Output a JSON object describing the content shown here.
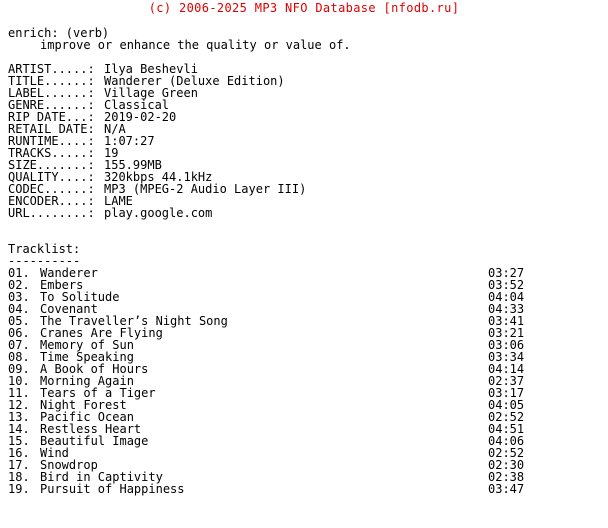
{
  "banner": {
    "text": "(c) 2006-2025 MP3 NFO Database [nfodb.ru]",
    "color": "#e00000"
  },
  "definition": {
    "term": "enrich: (verb)",
    "meaning": "improve or enhance the quality or value of."
  },
  "metadata": [
    {
      "key": "ARTIST.....:",
      "value": "Ilya Beshevli"
    },
    {
      "key": "TITLE......:",
      "value": "Wanderer (Deluxe Edition)"
    },
    {
      "key": "LABEL......:",
      "value": "Village Green"
    },
    {
      "key": "GENRE......:",
      "value": "Classical"
    },
    {
      "key": "RIP DATE...:",
      "value": "2019-02-20"
    },
    {
      "key": "RETAIL DATE:",
      "value": "N/A"
    },
    {
      "key": "RUNTIME....:",
      "value": "1:07:27"
    },
    {
      "key": "TRACKS.....:",
      "value": "19"
    },
    {
      "key": "SIZE.......:",
      "value": "155.99MB"
    },
    {
      "key": "QUALITY....:",
      "value": "320kbps 44.1kHz"
    },
    {
      "key": "CODEC......:",
      "value": "MP3 (MPEG-2 Audio Layer III)"
    },
    {
      "key": "ENCODER....:",
      "value": "LAME"
    },
    {
      "key": "URL........:",
      "value": "play.google.com"
    }
  ],
  "tracklist": {
    "heading": "Tracklist:",
    "rule": "----------",
    "tracks": [
      {
        "num": "01.",
        "title": "Wanderer",
        "time": "03:27"
      },
      {
        "num": "02.",
        "title": "Embers",
        "time": "03:52"
      },
      {
        "num": "03.",
        "title": "To Solitude",
        "time": "04:04"
      },
      {
        "num": "04.",
        "title": "Covenant",
        "time": "04:33"
      },
      {
        "num": "05.",
        "title": "The Traveller’s Night Song",
        "time": "03:41"
      },
      {
        "num": "06.",
        "title": "Cranes Are Flying",
        "time": "03:21"
      },
      {
        "num": "07.",
        "title": "Memory of Sun",
        "time": "03:06"
      },
      {
        "num": "08.",
        "title": "Time Speaking",
        "time": "03:34"
      },
      {
        "num": "09.",
        "title": "A Book of Hours",
        "time": "04:14"
      },
      {
        "num": "10.",
        "title": "Morning Again",
        "time": "02:37"
      },
      {
        "num": "11.",
        "title": "Tears of a Tiger",
        "time": "03:17"
      },
      {
        "num": "12.",
        "title": "Night Forest",
        "time": "04:05"
      },
      {
        "num": "13.",
        "title": "Pacific Ocean",
        "time": "02:52"
      },
      {
        "num": "14.",
        "title": "Restless Heart",
        "time": "04:51"
      },
      {
        "num": "15.",
        "title": "Beautiful Image",
        "time": "04:06"
      },
      {
        "num": "16.",
        "title": "Wind",
        "time": "02:52"
      },
      {
        "num": "17.",
        "title": "Snowdrop",
        "time": "02:30"
      },
      {
        "num": "18.",
        "title": "Bird in Captivity",
        "time": "02:38"
      },
      {
        "num": "19.",
        "title": "Pursuit of Happiness",
        "time": "03:47"
      }
    ]
  }
}
